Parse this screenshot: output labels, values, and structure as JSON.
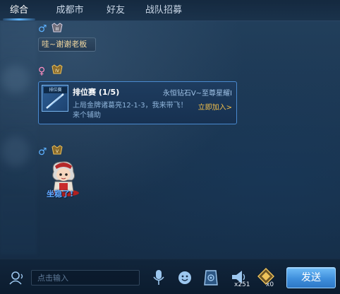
{
  "tabs": [
    {
      "label": "综合",
      "active": true
    },
    {
      "label": "成都市",
      "active": false
    },
    {
      "label": "好友",
      "active": false
    },
    {
      "label": "战队招募",
      "active": false
    }
  ],
  "messages": [
    {
      "gender": "♂",
      "gender_color": "#5db1ff",
      "text": "哇~谢谢老板"
    },
    {
      "gender": "♀",
      "gender_color": "#ff8fc2",
      "invite": {
        "thumb_label": "排位赛",
        "title": "排位赛",
        "progress": "(1/5)",
        "rank_range": "永恒钻石V~至尊星耀I",
        "message": "上局金牌诸葛亮12-1-3，我来带飞！ 来个辅助",
        "join_label": "立即加入>"
      }
    },
    {
      "gender": "♂",
      "gender_color": "#5db1ff",
      "sticker_text": "坐稳了!"
    }
  ],
  "input": {
    "placeholder": "点击输入"
  },
  "counts": {
    "horn": "x251",
    "gift": "x0"
  },
  "send_label": "发送",
  "colors": {
    "accent": "#5fb6ff",
    "join": "#f3c04a",
    "send": "#3f8fdc"
  }
}
